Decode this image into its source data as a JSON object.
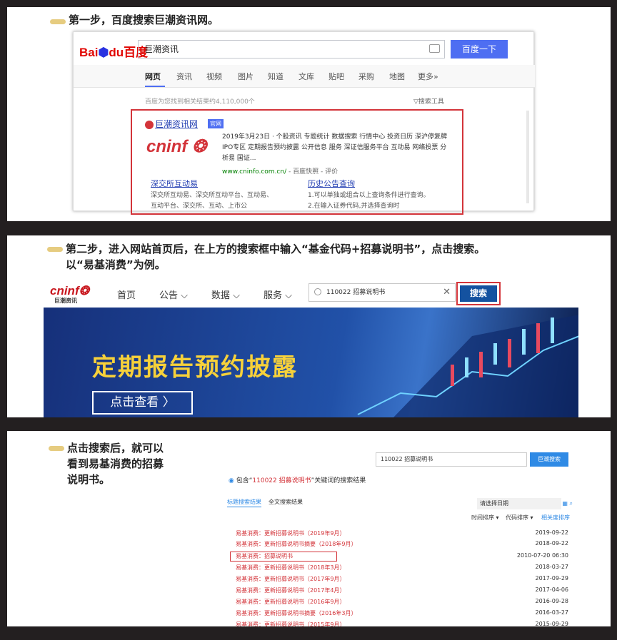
{
  "steps": {
    "step1": "第一步，百度搜索巨潮资讯网。",
    "step2_line1": "第二步，进入网站首页后，在上方的搜索框中输入“基金代码+招募说明书”，点击搜索。",
    "step2_line2": "以“易基消费”为例。",
    "step3_line1": "点击搜索后，就可以",
    "step3_line2": "看到易基消费的招募",
    "step3_line3": "说明书。"
  },
  "baidu": {
    "logo_text": "Bai",
    "logo_paw": "du",
    "logo_cn": "百度",
    "query": "巨潮资讯",
    "search_button": "百度一下",
    "tabs": [
      "网页",
      "资讯",
      "视频",
      "图片",
      "知道",
      "文库",
      "贴吧",
      "采购",
      "地图",
      "更多»"
    ],
    "result_count": "百度为您找到相关结果约4,110,000个",
    "search_tools": "搜索工具",
    "result": {
      "title": "巨潮资讯网",
      "badge": "官网",
      "logo": "cninf",
      "description": "2019年3月23日 · 个股资讯 专题统计 数据搜索 行情中心 投资日历 深沪停复牌 IPO专区 定期报告预约披露 公开信息 服务 深证信服务平台 互动易 网络投票 分析易 国证...",
      "url": "www.cninfo.com.cn/",
      "url_extra": " - 百度快照 - 评价",
      "sub1_title": "深交所互动易",
      "sub1_desc_1": "深交所互动易、深交所互动平台、互动易、",
      "sub1_desc_2": "互动平台、深交所、互动、上市公",
      "sub2_title": "历史公告查询",
      "sub2_desc_1": "1.可以单独或组合以上查询条件进行查询。",
      "sub2_desc_2": "2.在输入证券代码,并选择查询时"
    }
  },
  "cninfo": {
    "logo": "cninf",
    "logo_sub": "巨潮资讯",
    "menu": [
      "首页",
      "公告 ⌵",
      "数据 ⌵",
      "服务 ⌵"
    ],
    "search_value": "110022 招募说明书",
    "clear": "✕",
    "search_button": "搜索",
    "banner_title": "定期报告预约披露",
    "banner_button": "点击查看 〉"
  },
  "results_page": {
    "search_value": "110022 招募说明书",
    "search_button": "巨潮搜索",
    "heading_prefix": "包含“",
    "heading_query": "110022 招募说明书",
    "heading_suffix": "”关键词的搜索结果",
    "tab_active": "标题搜索结果",
    "tab_other": "全文搜索结果",
    "date_placeholder": "请选择日期",
    "sort1": "时间排序 ▾",
    "sort2": "代码排序 ▾",
    "sort3": "相关度排序",
    "rows": [
      {
        "title": "易基消费：更新招募说明书（2019年9月）",
        "date": "2019-09-22"
      },
      {
        "title": "易基消费：更新招募说明书摘要（2018年9月）",
        "date": "2018-09-22"
      },
      {
        "title": "易基消费：招募说明书",
        "date": "2010-07-20 06:30"
      },
      {
        "title": "易基消费：更新招募说明书（2018年3月）",
        "date": "2018-03-27"
      },
      {
        "title": "易基消费：更新招募说明书（2017年9月）",
        "date": "2017-09-29"
      },
      {
        "title": "易基消费：更新招募说明书（2017年4月）",
        "date": "2017-04-06"
      },
      {
        "title": "易基消费：更新招募说明书（2016年9月）",
        "date": "2016-09-28"
      },
      {
        "title": "易基消费：更新招募说明书摘要（2016年3月）",
        "date": "2016-03-27"
      },
      {
        "title": "易基消费：更新招募说明书（2015年9月）",
        "date": "2015-09-29"
      }
    ]
  }
}
